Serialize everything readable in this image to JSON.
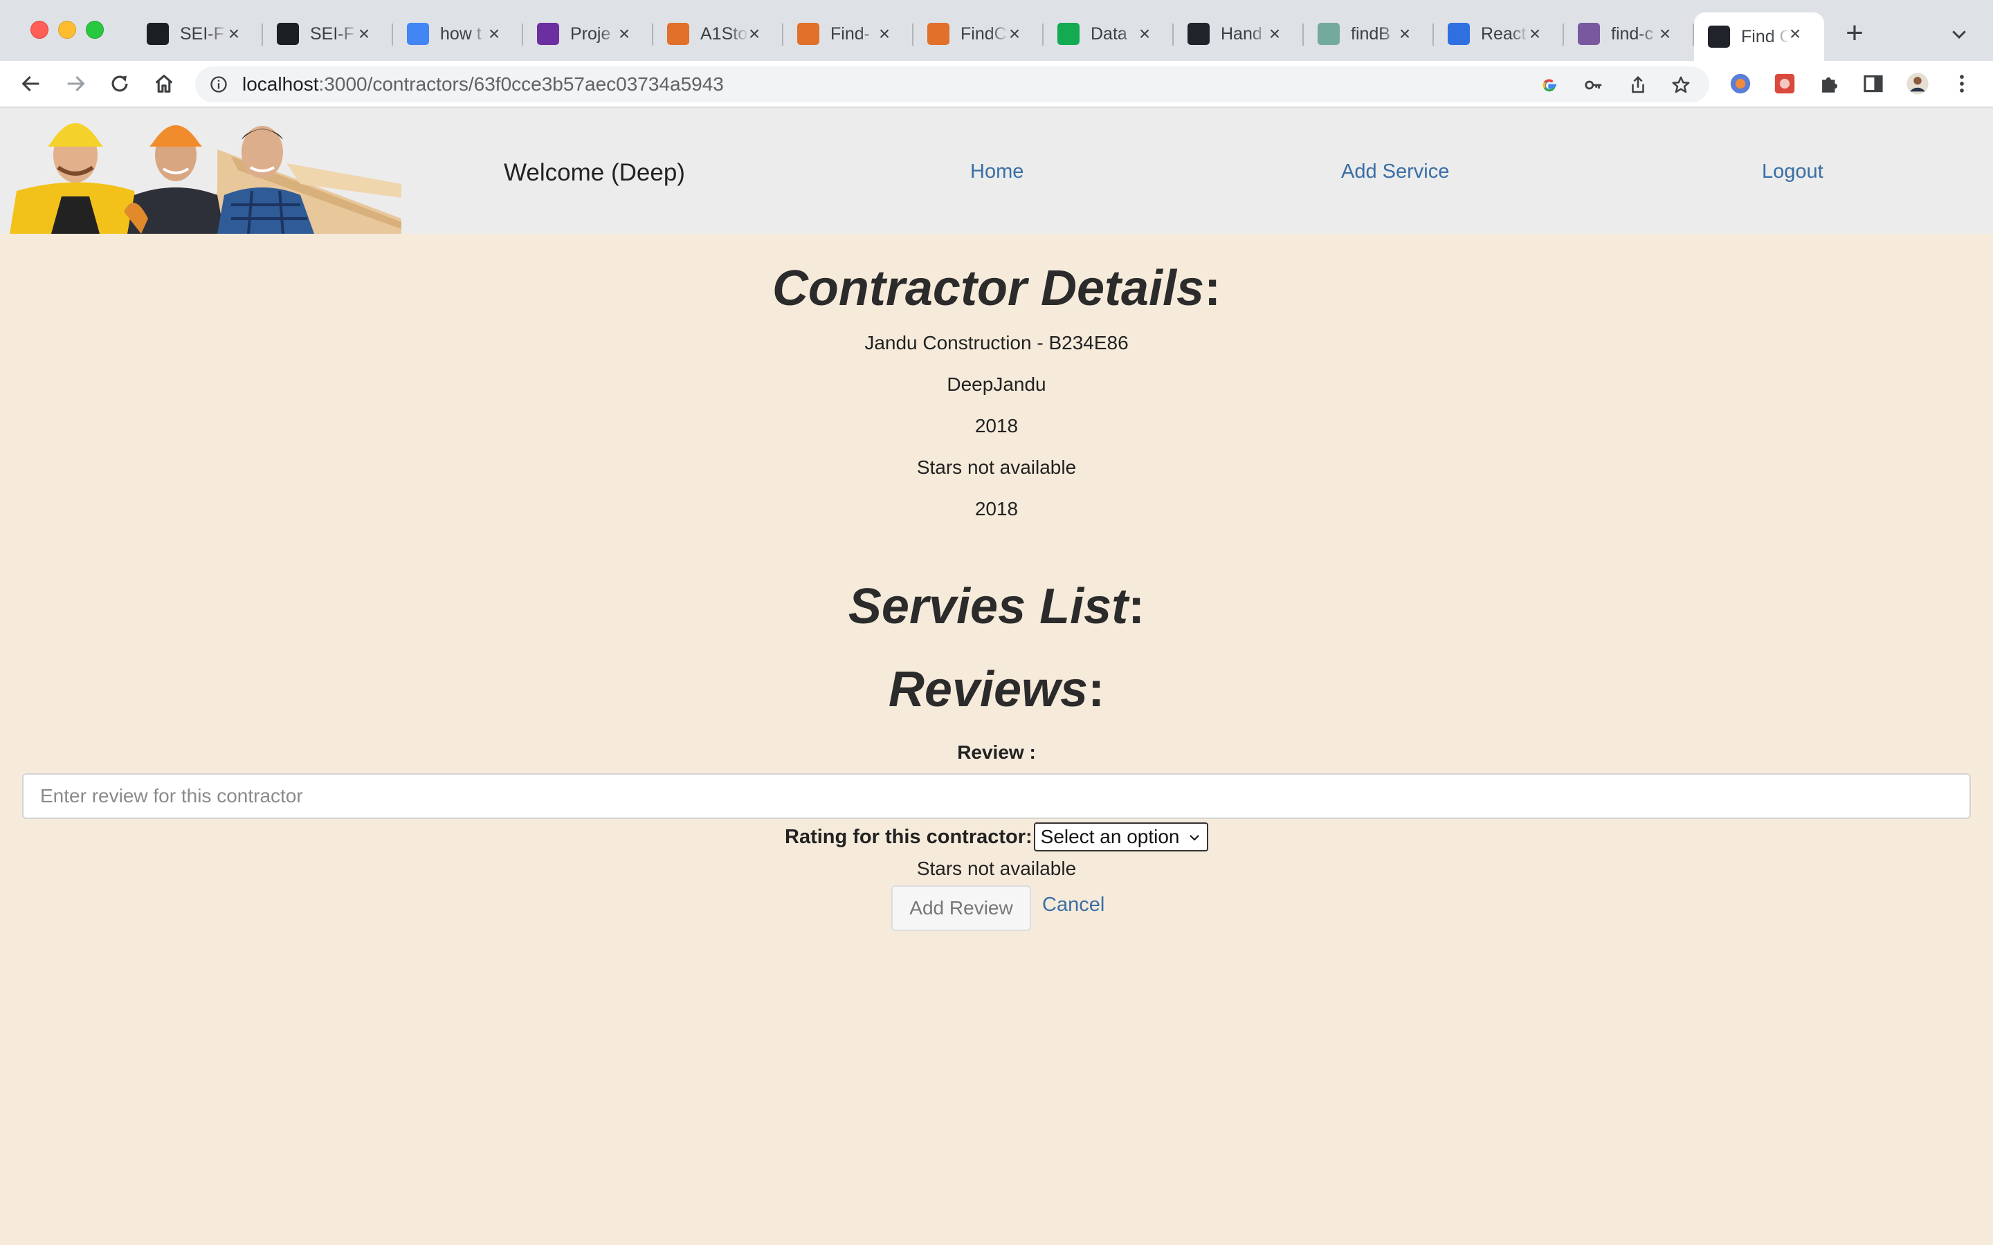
{
  "browser": {
    "tabs": [
      {
        "title": "SEI-F",
        "icon": "github-icon",
        "color": "#1b1f23"
      },
      {
        "title": "SEI-F",
        "icon": "github-icon",
        "color": "#1b1f23"
      },
      {
        "title": "how t",
        "icon": "google-icon",
        "color": "#4285f4"
      },
      {
        "title": "Proje",
        "icon": "project-icon",
        "color": "#6b2fa0"
      },
      {
        "title": "A1Sto",
        "icon": "find-icon",
        "color": "#e0702a"
      },
      {
        "title": "Find-",
        "icon": "find-icon",
        "color": "#e0702a"
      },
      {
        "title": "FindC",
        "icon": "find-icon",
        "color": "#e0702a"
      },
      {
        "title": "Data",
        "icon": "mongodb-icon",
        "color": "#13aa52"
      },
      {
        "title": "Hand",
        "icon": "react-icon",
        "color": "#20232a"
      },
      {
        "title": "findB",
        "icon": "chatgpt-icon",
        "color": "#74aa9c"
      },
      {
        "title": "React",
        "icon": "react-docs-icon",
        "color": "#2f6fe0"
      },
      {
        "title": "find-c",
        "icon": "heroku-icon",
        "color": "#79589f"
      },
      {
        "title": "Find C",
        "icon": "react-icon",
        "color": "#20232a"
      }
    ],
    "url_host": "localhost",
    "url_path": ":3000/contractors/63f0cce3b57aec03734a5943"
  },
  "header": {
    "welcome": "Welcome (Deep)",
    "nav": {
      "home": "Home",
      "add_service": "Add Service",
      "logout": "Logout"
    }
  },
  "details": {
    "title": "Contractor Details",
    "title_suffix": ":",
    "company": "Jandu Construction - B234E86",
    "name": "DeepJandu",
    "year": "2018",
    "stars": "Stars not available",
    "year_repeat": "2018"
  },
  "services": {
    "title": "Servies List",
    "title_suffix": ":"
  },
  "reviews": {
    "title": "Reviews",
    "title_suffix": ":",
    "review_label": "Review :",
    "review_placeholder": "Enter review for this contractor",
    "rating_label": "Rating for this contractor:",
    "rating_selected": "Select an option",
    "stars": "Stars not available",
    "add_button": "Add Review",
    "cancel": "Cancel"
  }
}
